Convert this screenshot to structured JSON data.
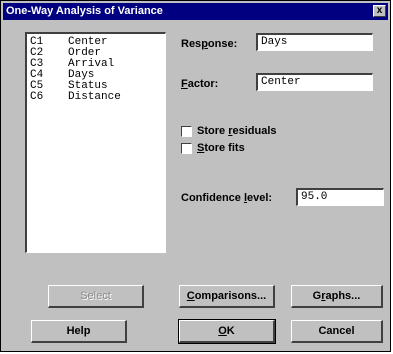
{
  "window": {
    "title": "One-Way Analysis of Variance",
    "close_label": "x"
  },
  "variables": [
    {
      "col": "C1",
      "name": "Center"
    },
    {
      "col": "C2",
      "name": "Order"
    },
    {
      "col": "C3",
      "name": "Arrival"
    },
    {
      "col": "C4",
      "name": "Days"
    },
    {
      "col": "C5",
      "name": "Status"
    },
    {
      "col": "C6",
      "name": "Distance"
    }
  ],
  "response": {
    "label_pre": "Res",
    "label_key": "p",
    "label_post": "onse:",
    "value": "Days"
  },
  "factor": {
    "label_pre": "",
    "label_key": "F",
    "label_post": "actor:",
    "value": "Center"
  },
  "store_residuals": {
    "label_pre": "Store ",
    "label_key": "r",
    "label_post": "esiduals",
    "checked": false
  },
  "store_fits": {
    "label_pre": "",
    "label_key": "S",
    "label_post": "tore fits",
    "checked": false
  },
  "confidence": {
    "label_pre": "Confidence ",
    "label_key": "l",
    "label_post": "evel:",
    "value": "95.0"
  },
  "buttons": {
    "select": "Select",
    "comparisons_key": "C",
    "comparisons_rest": "omparisons...",
    "graphs_pre": "G",
    "graphs_key": "r",
    "graphs_post": "aphs...",
    "help": "Help",
    "ok_key": "O",
    "ok_rest": "K",
    "cancel": "Cancel"
  }
}
